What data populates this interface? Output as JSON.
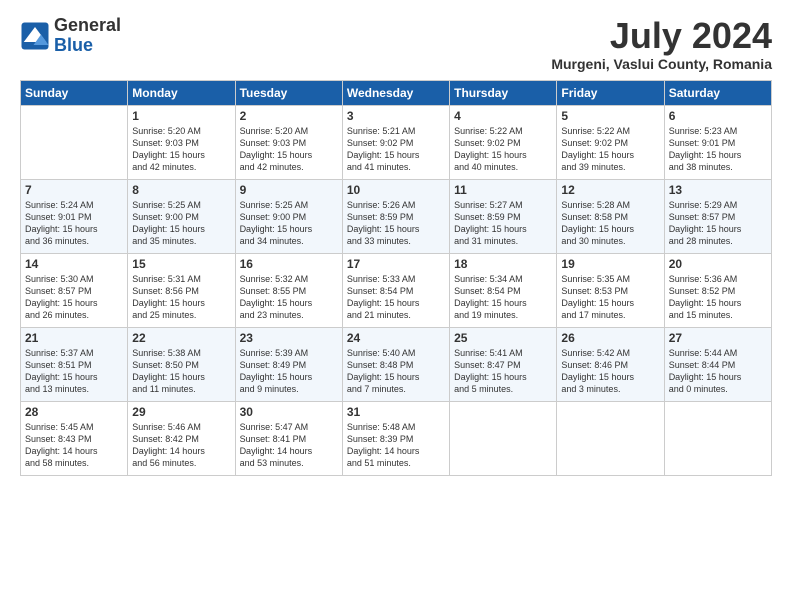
{
  "header": {
    "logo": {
      "general": "General",
      "blue": "Blue"
    },
    "title": "July 2024",
    "location": "Murgeni, Vaslui County, Romania"
  },
  "columns": [
    "Sunday",
    "Monday",
    "Tuesday",
    "Wednesday",
    "Thursday",
    "Friday",
    "Saturday"
  ],
  "weeks": [
    [
      {
        "day": "",
        "info": ""
      },
      {
        "day": "1",
        "info": "Sunrise: 5:20 AM\nSunset: 9:03 PM\nDaylight: 15 hours\nand 42 minutes."
      },
      {
        "day": "2",
        "info": "Sunrise: 5:20 AM\nSunset: 9:03 PM\nDaylight: 15 hours\nand 42 minutes."
      },
      {
        "day": "3",
        "info": "Sunrise: 5:21 AM\nSunset: 9:02 PM\nDaylight: 15 hours\nand 41 minutes."
      },
      {
        "day": "4",
        "info": "Sunrise: 5:22 AM\nSunset: 9:02 PM\nDaylight: 15 hours\nand 40 minutes."
      },
      {
        "day": "5",
        "info": "Sunrise: 5:22 AM\nSunset: 9:02 PM\nDaylight: 15 hours\nand 39 minutes."
      },
      {
        "day": "6",
        "info": "Sunrise: 5:23 AM\nSunset: 9:01 PM\nDaylight: 15 hours\nand 38 minutes."
      }
    ],
    [
      {
        "day": "7",
        "info": "Sunrise: 5:24 AM\nSunset: 9:01 PM\nDaylight: 15 hours\nand 36 minutes."
      },
      {
        "day": "8",
        "info": "Sunrise: 5:25 AM\nSunset: 9:00 PM\nDaylight: 15 hours\nand 35 minutes."
      },
      {
        "day": "9",
        "info": "Sunrise: 5:25 AM\nSunset: 9:00 PM\nDaylight: 15 hours\nand 34 minutes."
      },
      {
        "day": "10",
        "info": "Sunrise: 5:26 AM\nSunset: 8:59 PM\nDaylight: 15 hours\nand 33 minutes."
      },
      {
        "day": "11",
        "info": "Sunrise: 5:27 AM\nSunset: 8:59 PM\nDaylight: 15 hours\nand 31 minutes."
      },
      {
        "day": "12",
        "info": "Sunrise: 5:28 AM\nSunset: 8:58 PM\nDaylight: 15 hours\nand 30 minutes."
      },
      {
        "day": "13",
        "info": "Sunrise: 5:29 AM\nSunset: 8:57 PM\nDaylight: 15 hours\nand 28 minutes."
      }
    ],
    [
      {
        "day": "14",
        "info": "Sunrise: 5:30 AM\nSunset: 8:57 PM\nDaylight: 15 hours\nand 26 minutes."
      },
      {
        "day": "15",
        "info": "Sunrise: 5:31 AM\nSunset: 8:56 PM\nDaylight: 15 hours\nand 25 minutes."
      },
      {
        "day": "16",
        "info": "Sunrise: 5:32 AM\nSunset: 8:55 PM\nDaylight: 15 hours\nand 23 minutes."
      },
      {
        "day": "17",
        "info": "Sunrise: 5:33 AM\nSunset: 8:54 PM\nDaylight: 15 hours\nand 21 minutes."
      },
      {
        "day": "18",
        "info": "Sunrise: 5:34 AM\nSunset: 8:54 PM\nDaylight: 15 hours\nand 19 minutes."
      },
      {
        "day": "19",
        "info": "Sunrise: 5:35 AM\nSunset: 8:53 PM\nDaylight: 15 hours\nand 17 minutes."
      },
      {
        "day": "20",
        "info": "Sunrise: 5:36 AM\nSunset: 8:52 PM\nDaylight: 15 hours\nand 15 minutes."
      }
    ],
    [
      {
        "day": "21",
        "info": "Sunrise: 5:37 AM\nSunset: 8:51 PM\nDaylight: 15 hours\nand 13 minutes."
      },
      {
        "day": "22",
        "info": "Sunrise: 5:38 AM\nSunset: 8:50 PM\nDaylight: 15 hours\nand 11 minutes."
      },
      {
        "day": "23",
        "info": "Sunrise: 5:39 AM\nSunset: 8:49 PM\nDaylight: 15 hours\nand 9 minutes."
      },
      {
        "day": "24",
        "info": "Sunrise: 5:40 AM\nSunset: 8:48 PM\nDaylight: 15 hours\nand 7 minutes."
      },
      {
        "day": "25",
        "info": "Sunrise: 5:41 AM\nSunset: 8:47 PM\nDaylight: 15 hours\nand 5 minutes."
      },
      {
        "day": "26",
        "info": "Sunrise: 5:42 AM\nSunset: 8:46 PM\nDaylight: 15 hours\nand 3 minutes."
      },
      {
        "day": "27",
        "info": "Sunrise: 5:44 AM\nSunset: 8:44 PM\nDaylight: 15 hours\nand 0 minutes."
      }
    ],
    [
      {
        "day": "28",
        "info": "Sunrise: 5:45 AM\nSunset: 8:43 PM\nDaylight: 14 hours\nand 58 minutes."
      },
      {
        "day": "29",
        "info": "Sunrise: 5:46 AM\nSunset: 8:42 PM\nDaylight: 14 hours\nand 56 minutes."
      },
      {
        "day": "30",
        "info": "Sunrise: 5:47 AM\nSunset: 8:41 PM\nDaylight: 14 hours\nand 53 minutes."
      },
      {
        "day": "31",
        "info": "Sunrise: 5:48 AM\nSunset: 8:39 PM\nDaylight: 14 hours\nand 51 minutes."
      },
      {
        "day": "",
        "info": ""
      },
      {
        "day": "",
        "info": ""
      },
      {
        "day": "",
        "info": ""
      }
    ]
  ]
}
